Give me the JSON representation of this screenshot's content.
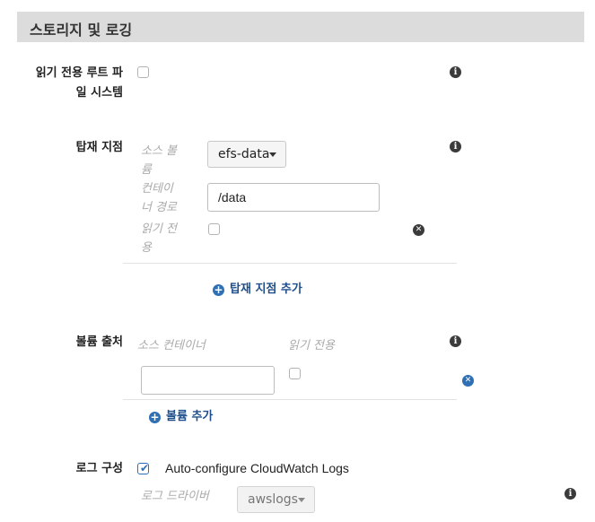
{
  "section": {
    "title": "스토리지 및 로깅"
  },
  "readonly_root_fs": {
    "label_line1": "읽기 전용 루트 파",
    "label_line2": "일 시스템",
    "checked": false
  },
  "mount_points": {
    "label": "탑재 지점",
    "source_volume": {
      "label_line1": "소스 볼",
      "label_line2": "륨",
      "value": "efs-data"
    },
    "container_path": {
      "label_line1": "컨테이",
      "label_line2": "너 경로",
      "value": "/data"
    },
    "read_only": {
      "label_line1": "읽기 전",
      "label_line2": "용",
      "checked": false
    },
    "add_label": "탑재 지점 추가"
  },
  "volumes_from": {
    "label": "볼륨 출처",
    "col_source_container": "소스 컨테이너",
    "col_read_only": "읽기 전용",
    "source_container_value": "",
    "read_only_checked": false,
    "add_label": "볼륨 추가"
  },
  "log_configuration": {
    "label": "로그 구성",
    "auto_configure_label": "Auto-configure CloudWatch Logs",
    "auto_configure_checked": true,
    "log_driver_label": "로그 드라이버",
    "log_driver_value": "awslogs"
  },
  "icons": {
    "info": "info-icon",
    "remove": "remove-icon",
    "add": "plus-circle-icon",
    "check": "check-icon",
    "caret": "caret-down-icon"
  },
  "colors": {
    "header_bg": "#dcdcdc",
    "link": "#1f4e8c",
    "accent": "#2f6fb4"
  }
}
